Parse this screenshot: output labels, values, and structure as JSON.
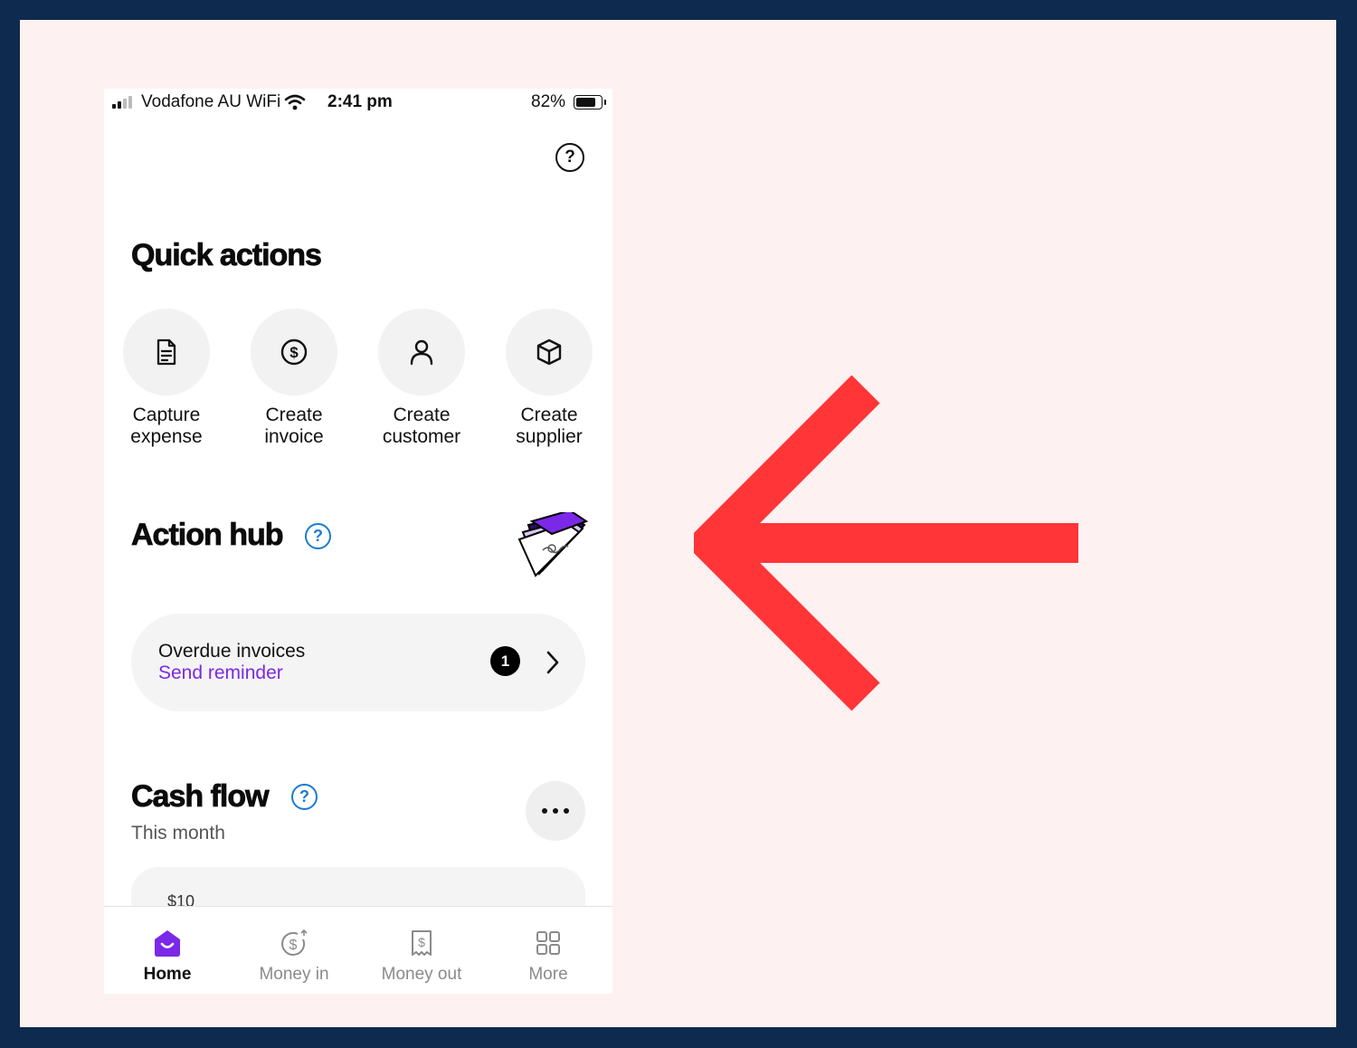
{
  "status_bar": {
    "carrier": "Vodafone AU WiFi",
    "time": "2:41 pm",
    "battery_percent": "82%",
    "battery_level": 0.82
  },
  "header": {
    "help_label": "?"
  },
  "quick_actions": {
    "title": "Quick actions",
    "items": [
      {
        "line1": "Capture",
        "line2": "expense",
        "icon": "document-icon"
      },
      {
        "line1": "Create",
        "line2": "invoice",
        "icon": "dollar-circle-icon"
      },
      {
        "line1": "Create",
        "line2": "customer",
        "icon": "person-icon"
      },
      {
        "line1": "Create",
        "line2": "supplier",
        "icon": "box-icon"
      }
    ]
  },
  "action_hub": {
    "title": "Action hub",
    "help_label": "?",
    "card": {
      "title": "Overdue invoices",
      "action": "Send reminder",
      "count": "1"
    }
  },
  "cash_flow": {
    "title": "Cash flow",
    "help_label": "?",
    "subtitle": "This month",
    "first_value": "$10"
  },
  "tabbar": {
    "tabs": [
      {
        "label": "Home",
        "icon": "home-icon",
        "active": true
      },
      {
        "label": "Money in",
        "icon": "money-in-icon",
        "active": false
      },
      {
        "label": "Money out",
        "icon": "receipt-icon",
        "active": false
      },
      {
        "label": "More",
        "icon": "grid-icon",
        "active": false
      }
    ]
  },
  "colors": {
    "accent_purple": "#7b28e8",
    "help_blue": "#1b7bd6",
    "arrow_red": "#ff3538",
    "frame_navy": "#0f2a4f",
    "canvas_pink": "#fdf1f1"
  }
}
